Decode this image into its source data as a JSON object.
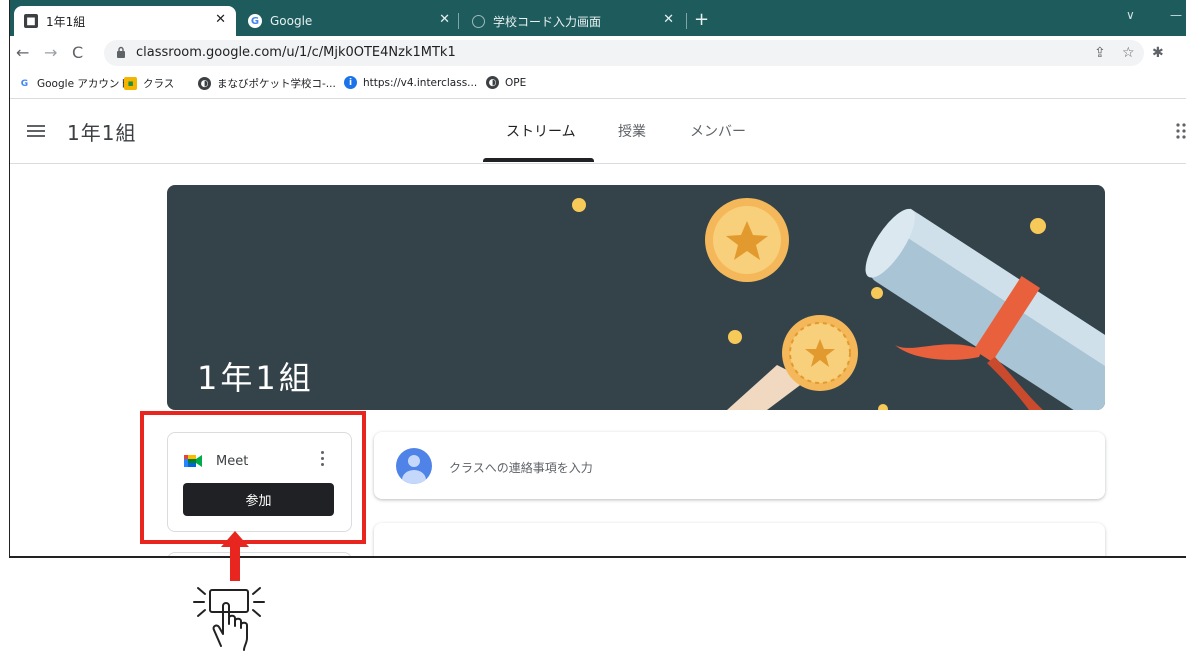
{
  "browser": {
    "tabs": [
      {
        "title": "1年1組",
        "active": true
      },
      {
        "title": "Google",
        "active": false
      },
      {
        "title": "学校コード入力画面",
        "active": false
      }
    ],
    "url": "classroom.google.com/u/1/c/Mjk0OTE4Nzk1MTk1",
    "bookmarks": [
      {
        "label": "Google アカウント",
        "icon": "google-icon"
      },
      {
        "label": "クラス",
        "icon": "classroom-icon"
      },
      {
        "label": "まなびポケット学校コ-...",
        "icon": "globe-icon"
      },
      {
        "label": "https://v4.interclass...",
        "icon": "info-icon"
      },
      {
        "label": "OPE",
        "icon": "globe-icon"
      }
    ]
  },
  "classroom": {
    "class_name": "1年1組",
    "nav_tabs": [
      "ストリーム",
      "授業",
      "メンバー"
    ],
    "active_tab": "ストリーム",
    "banner_title": "1年1組",
    "meet": {
      "label": "Meet",
      "join_label": "参加"
    },
    "announce_placeholder": "クラスへの連絡事項を入力"
  },
  "colors": {
    "tabstrip": "#1e5b5c",
    "banner": "#34434a",
    "highlight": "#e8251f",
    "join_button": "#202124"
  }
}
